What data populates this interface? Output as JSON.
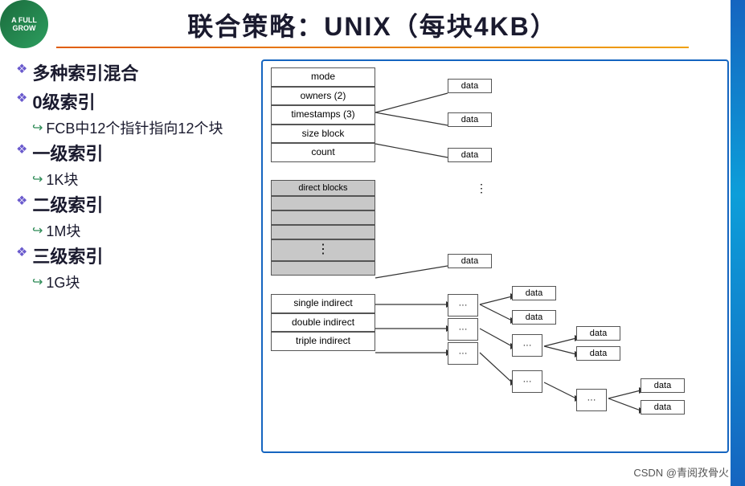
{
  "header": {
    "title": "联合策略：UNIX（每块4KB）"
  },
  "left": {
    "bullets": [
      {
        "id": "mixed",
        "text": "多种索引混合"
      },
      {
        "id": "level0",
        "text": "0级索引"
      },
      {
        "id": "fcb-desc",
        "sub": true,
        "text": "FCB中12个指针指向12个块"
      },
      {
        "id": "level1",
        "text": "一级索引"
      },
      {
        "id": "1k",
        "sub": true,
        "text": "1K块"
      },
      {
        "id": "level2",
        "text": "二级索引"
      },
      {
        "id": "1m",
        "sub": true,
        "text": "1M块"
      },
      {
        "id": "level3",
        "text": "三级索引"
      },
      {
        "id": "1g",
        "sub": true,
        "text": "1G块"
      }
    ]
  },
  "diagram": {
    "inode_rows": [
      {
        "id": "mode",
        "label": "mode",
        "gray": false
      },
      {
        "id": "owners",
        "label": "owners (2)",
        "gray": false
      },
      {
        "id": "timestamps",
        "label": "timestamps (3)",
        "gray": false
      },
      {
        "id": "size-block",
        "label": "size block",
        "gray": false
      },
      {
        "id": "count",
        "label": "count",
        "gray": false
      }
    ],
    "direct_label": "direct blocks",
    "indirect_rows": [
      {
        "id": "single-indirect",
        "label": "single indirect"
      },
      {
        "id": "double-indirect",
        "label": "double indirect"
      },
      {
        "id": "triple-indirect",
        "label": "triple indirect"
      }
    ],
    "data_boxes": [
      {
        "id": "data1",
        "label": "data"
      },
      {
        "id": "data2",
        "label": "data"
      },
      {
        "id": "data3",
        "label": "data"
      },
      {
        "id": "data4",
        "label": "data"
      },
      {
        "id": "data5",
        "label": "data"
      },
      {
        "id": "data6",
        "label": "data"
      },
      {
        "id": "data7",
        "label": "data"
      },
      {
        "id": "data8",
        "label": "data"
      },
      {
        "id": "data9",
        "label": "data"
      },
      {
        "id": "data10",
        "label": "data"
      }
    ]
  },
  "footer": {
    "text": "CSDN @青阅孜骨火"
  }
}
